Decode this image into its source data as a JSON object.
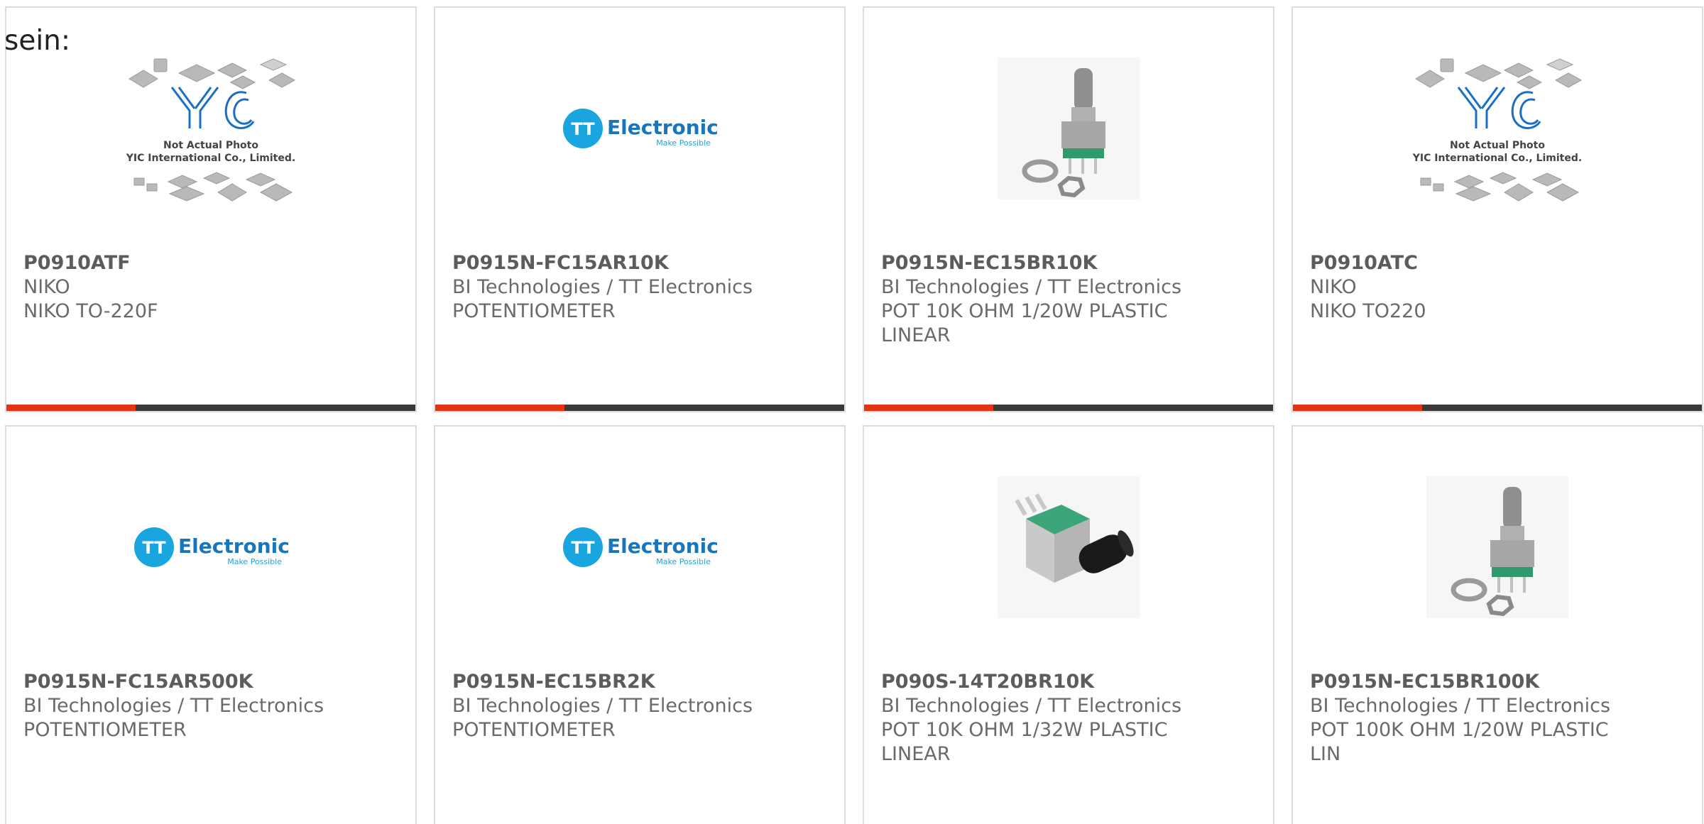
{
  "intro_text": "sein:",
  "colors": {
    "accent": "#e63312",
    "bar_dark": "#3a3a3a",
    "tt_blue": "#19a5e0",
    "yic_blue": "#1a6fc4",
    "pot_green": "#2f9a6a"
  },
  "cards": [
    {
      "image": "yic-placeholder",
      "placeholder_line1": "Not Actual Photo",
      "placeholder_line2": "YIC International Co., Limited.",
      "part_number": "P0910ATF",
      "manufacturer": "NIKO",
      "description": "NIKO TO-220F"
    },
    {
      "image": "tt-electronics-logo",
      "logo_text": "Electronics",
      "logo_tagline": "Make Possible",
      "part_number": "P0915N-FC15AR10K",
      "manufacturer": "BI Technologies / TT Electronics",
      "description": "POTENTIOMETER"
    },
    {
      "image": "potentiometer-vertical-photo",
      "part_number": "P0915N-EC15BR10K",
      "manufacturer": "BI Technologies / TT Electronics",
      "description": "POT 10K OHM 1/20W PLASTIC LINEAR"
    },
    {
      "image": "yic-placeholder",
      "placeholder_line1": "Not Actual Photo",
      "placeholder_line2": "YIC International Co., Limited.",
      "part_number": "P0910ATC",
      "manufacturer": "NIKO",
      "description": "NIKO TO220"
    },
    {
      "image": "tt-electronics-logo",
      "logo_text": "Electronics",
      "logo_tagline": "Make Possible",
      "part_number": "P0915N-FC15AR500K",
      "manufacturer": "BI Technologies / TT Electronics",
      "description": "POTENTIOMETER"
    },
    {
      "image": "tt-electronics-logo",
      "logo_text": "Electronics",
      "logo_tagline": "Make Possible",
      "part_number": "P0915N-EC15BR2K",
      "manufacturer": "BI Technologies / TT Electronics",
      "description": "POTENTIOMETER"
    },
    {
      "image": "potentiometer-horizontal-photo",
      "part_number": "P090S-14T20BR10K",
      "manufacturer": "BI Technologies / TT Electronics",
      "description": "POT 10K OHM 1/32W PLASTIC LINEAR"
    },
    {
      "image": "potentiometer-vertical-photo",
      "part_number": "P0915N-EC15BR100K",
      "manufacturer": "BI Technologies / TT Electronics",
      "description": "POT 100K OHM 1/20W PLASTIC LIN"
    }
  ]
}
